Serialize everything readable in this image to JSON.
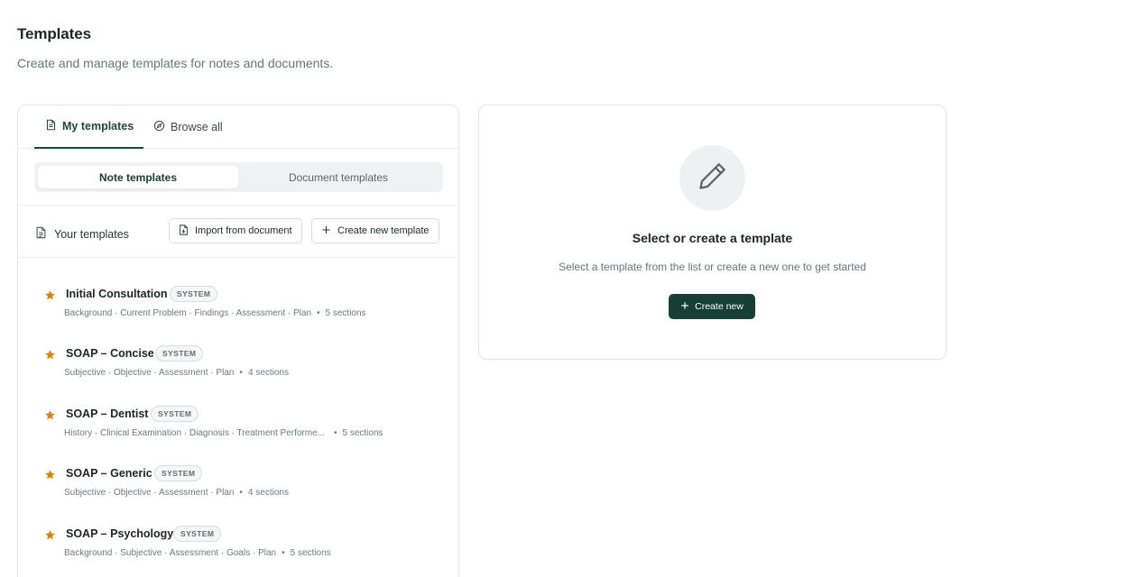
{
  "header": {
    "title": "Templates",
    "subtitle": "Create and manage templates for notes and documents."
  },
  "tabs": [
    {
      "label": "My templates",
      "icon": "document-icon",
      "active": true
    },
    {
      "label": "Browse all",
      "icon": "compass-icon",
      "active": false
    }
  ],
  "segmented": {
    "note_label": "Note templates",
    "document_label": "Document templates"
  },
  "your_templates": {
    "label": "Your templates",
    "import_label": "Import from document",
    "create_label": "Create new template"
  },
  "templates": [
    {
      "name": "Initial Consultation",
      "badge": "SYSTEM",
      "sections": "Background · Current Problem · Findings · Assessment · Plan",
      "count": "5 sections"
    },
    {
      "name": "SOAP – Concise",
      "badge": "SYSTEM",
      "sections": "Subjective · Objective · Assessment · Plan",
      "count": "4 sections"
    },
    {
      "name": "SOAP – Dentist",
      "badge": "SYSTEM",
      "sections": "History · Clinical Examination · Diagnosis · Treatment Performe...",
      "count": "5 sections"
    },
    {
      "name": "SOAP – Generic",
      "badge": "SYSTEM",
      "sections": "Subjective · Objective · Assessment · Plan",
      "count": "4 sections"
    },
    {
      "name": "SOAP – Psychology",
      "badge": "SYSTEM",
      "sections": "Background · Subjective · Assessment · Goals · Plan",
      "count": "5 sections"
    }
  ],
  "empty_state": {
    "title": "Select or create a template",
    "description": "Select a template from the list or create a new one to get started",
    "button_label": "Create new"
  },
  "colors": {
    "accent": "#173f33",
    "star": "#d9820f"
  }
}
